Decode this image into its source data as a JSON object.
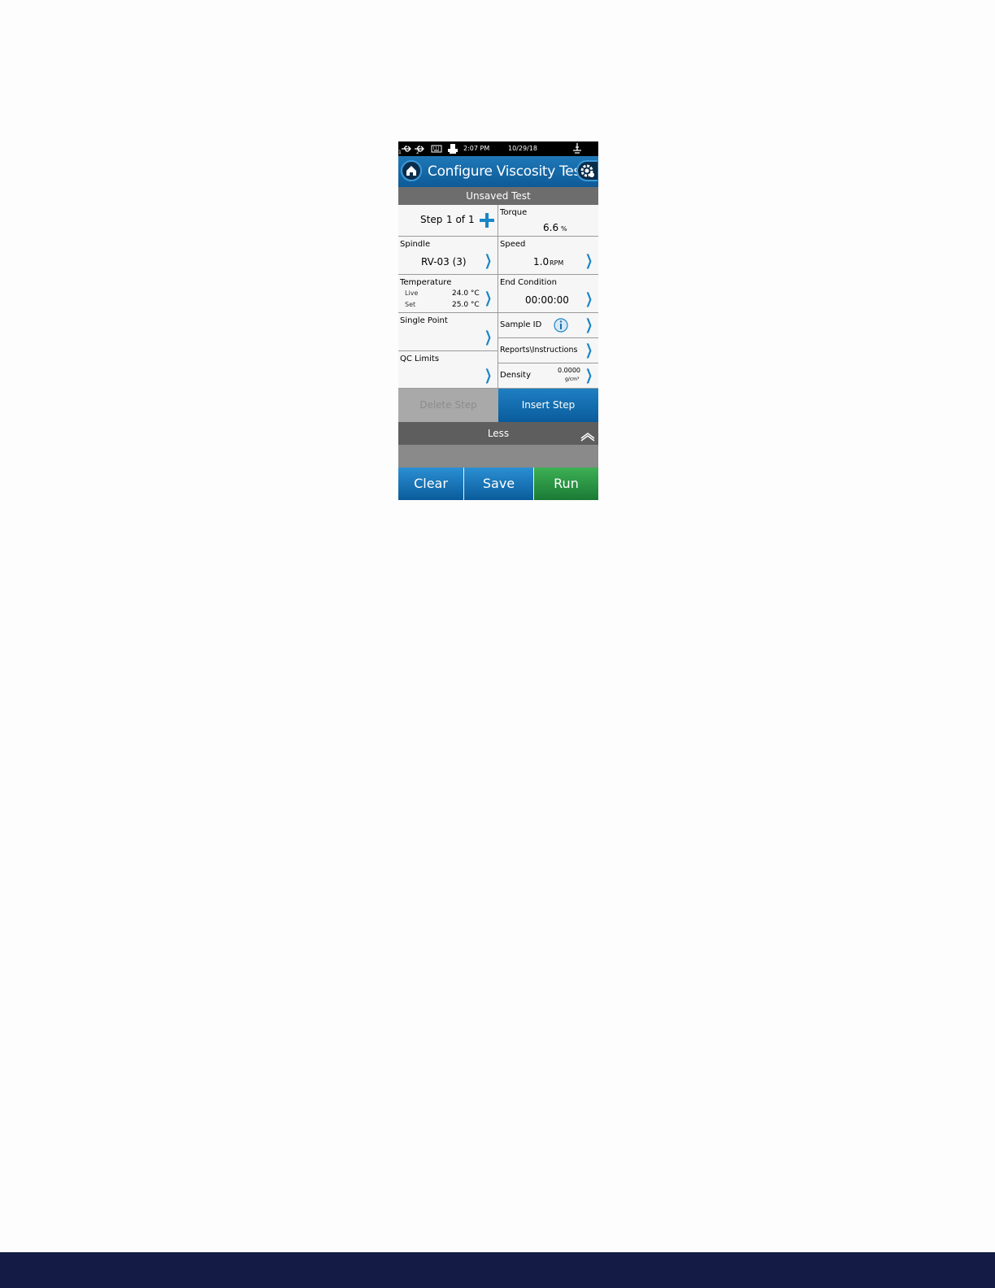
{
  "status": {
    "usb1": "1",
    "usb2": "2",
    "time": "2:07 PM",
    "date": "10/29/18"
  },
  "header": {
    "title": "Configure Viscosity Test",
    "subtitle": "Unsaved Test"
  },
  "step": {
    "label": "Step",
    "current": "1 of",
    "total": "1"
  },
  "torque": {
    "label": "Torque",
    "value": "6.6",
    "unit": "%"
  },
  "spindle": {
    "label": "Spindle",
    "value": "RV-03 (3)"
  },
  "speed": {
    "label": "Speed",
    "value": "1.0",
    "unit": "RPM"
  },
  "temperature": {
    "label": "Temperature",
    "live_label": "Live",
    "live_value": "24.0 °C",
    "set_label": "Set",
    "set_value": "25.0 °C"
  },
  "end_condition": {
    "label": "End Condition",
    "value": "00:00:00"
  },
  "single_point": {
    "label": "Single Point"
  },
  "sample_id": {
    "label": "Sample ID"
  },
  "reports": {
    "label": "Reports\\Instructions"
  },
  "qc_limits": {
    "label": "QC Limits"
  },
  "density": {
    "label": "Density",
    "value": "0.0000",
    "unit": "g/cm³"
  },
  "actions": {
    "delete_step": "Delete Step",
    "insert_step": "Insert Step",
    "less": "Less",
    "clear": "Clear",
    "save": "Save",
    "run": "Run"
  },
  "colors": {
    "accent": "#1a86c7",
    "run": "#2e9a47",
    "footer": "#141c45"
  }
}
